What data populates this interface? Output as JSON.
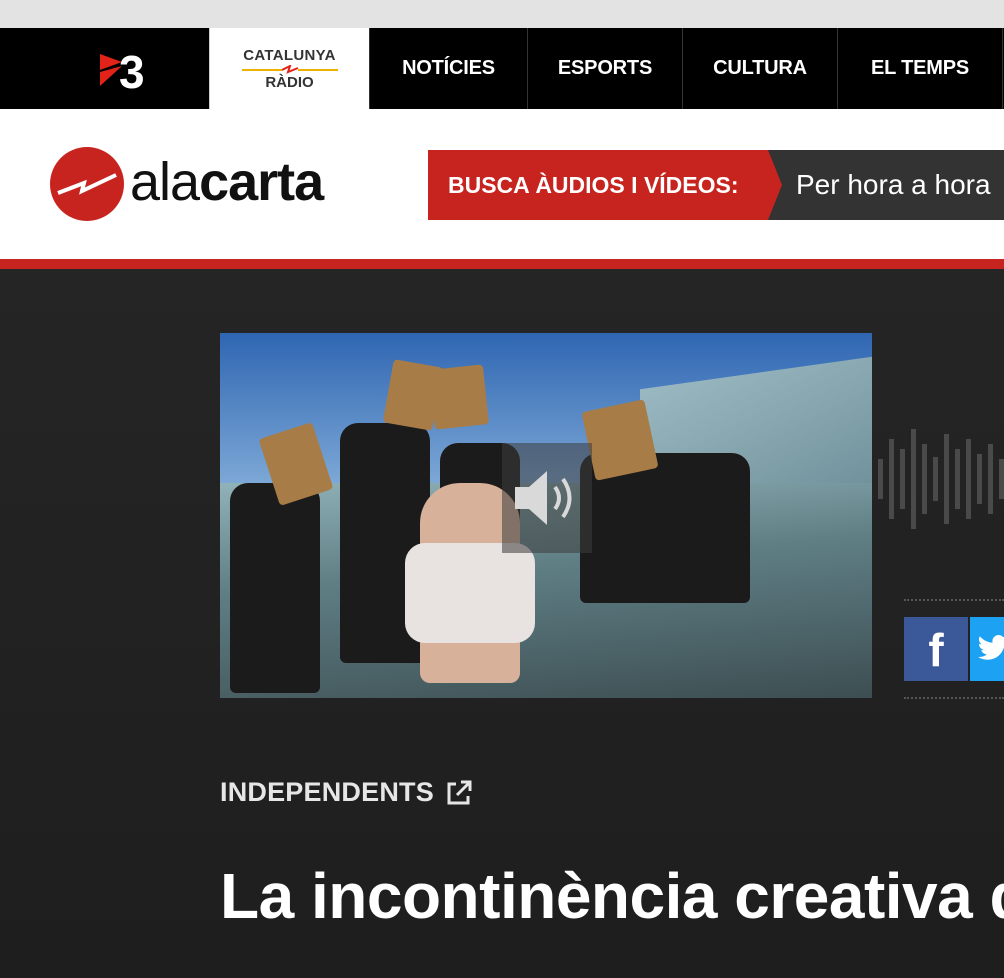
{
  "nav": {
    "brand": "3",
    "radio": {
      "top": "CATALUNYA",
      "bottom": "RÀDIO"
    },
    "items": [
      {
        "label": "NOTÍCIES"
      },
      {
        "label": "ESPORTS"
      },
      {
        "label": "CULTURA"
      },
      {
        "label": "EL TEMPS"
      }
    ]
  },
  "header": {
    "brand_light": "ala",
    "brand_bold": "carta",
    "search": {
      "label": "BUSCA ÀUDIOS I VÍDEOS:",
      "placeholder": "Per hora a hora"
    }
  },
  "content": {
    "program": "INDEPENDENTS",
    "title": "La incontinència creativa de..."
  },
  "colors": {
    "accent": "#c8241f",
    "nav_bg": "#000000",
    "facebook": "#3b5998",
    "twitter": "#1da1f2"
  },
  "icons": [
    "sound-icon",
    "external-link-icon",
    "facebook-icon",
    "twitter-icon"
  ]
}
